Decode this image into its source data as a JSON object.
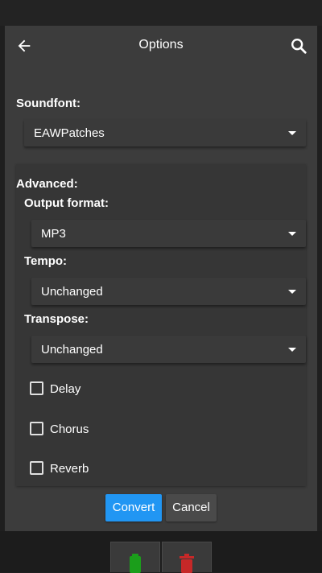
{
  "header": {
    "title": "Options"
  },
  "soundfont": {
    "label": "Soundfont:",
    "value": "EAWPatches"
  },
  "advanced": {
    "label": "Advanced:",
    "output_format": {
      "label": "Output format:",
      "value": "MP3"
    },
    "tempo": {
      "label": "Tempo:",
      "value": "Unchanged"
    },
    "transpose": {
      "label": "Transpose:",
      "value": "Unchanged"
    },
    "checkboxes": [
      {
        "label": "Delay",
        "checked": false
      },
      {
        "label": "Chorus",
        "checked": false
      },
      {
        "label": "Reverb",
        "checked": false
      }
    ]
  },
  "buttons": {
    "convert": "Convert",
    "cancel": "Cancel"
  },
  "colors": {
    "accent": "#2196f3",
    "dialog_bg": "#3c3c3c",
    "fab_green": "#1b9e1b",
    "fab_red": "#c62828"
  },
  "icons": {
    "back": "arrow-left-icon",
    "search": "search-icon",
    "fab_left": "green-file-icon",
    "fab_right": "red-trash-icon"
  }
}
